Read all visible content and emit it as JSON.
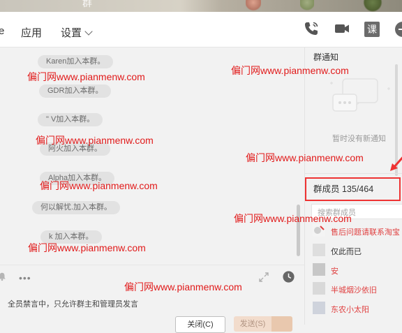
{
  "window": {
    "title_fragment": "群",
    "colors": {
      "watermark": "#e11a1a",
      "highlight_box": "#e33333",
      "member_red": "#e04040"
    }
  },
  "toolbar": {
    "fragment_char": "e",
    "tabs": [
      {
        "label": "应用"
      },
      {
        "label": "设置"
      }
    ],
    "icons": [
      "phone-icon",
      "video-icon",
      "class-icon",
      "add-icon"
    ],
    "class_icon_text": "课"
  },
  "chat": {
    "system_messages": [
      "Karen加入本群。",
      "GDR加入本群。",
      "\"    V加入本群。",
      "阿火加入本群。",
      "Alpha加入本群。",
      "何以解忧.加入本群。",
      "k    加入本群。"
    ]
  },
  "input": {
    "mute_notice": "全员禁言中，只允许群主和管理员发言",
    "close_label": "关闭(C)",
    "send_label": "发送(S)"
  },
  "right_panel": {
    "notice": {
      "title": "群通知",
      "empty_text": "暂时没有新通知"
    },
    "members": {
      "title": "群成员 135/464",
      "search_placeholder": "搜索群成员",
      "items": [
        {
          "name": "售后问题请联系淘宝",
          "color": "red"
        },
        {
          "name": "仅此而已",
          "color": "dark"
        },
        {
          "name": "安",
          "color": "red"
        },
        {
          "name": "半城烟沙依旧",
          "color": "red"
        },
        {
          "name": "东农小太阳",
          "color": "red"
        }
      ]
    }
  },
  "watermarks": [
    "偏门网www.pianmenw.com",
    "偏门网www.pianmenw.com",
    "偏门网www.pianmenw.com",
    "偏门网www.pianmenw.com",
    "偏门网www.pianmenw.com",
    "偏门网www.pianmenw.com",
    "偏门网www.pianmenw.com",
    "偏门网www.pianmenw.com",
    "偏门网www.pianmenw.com"
  ]
}
